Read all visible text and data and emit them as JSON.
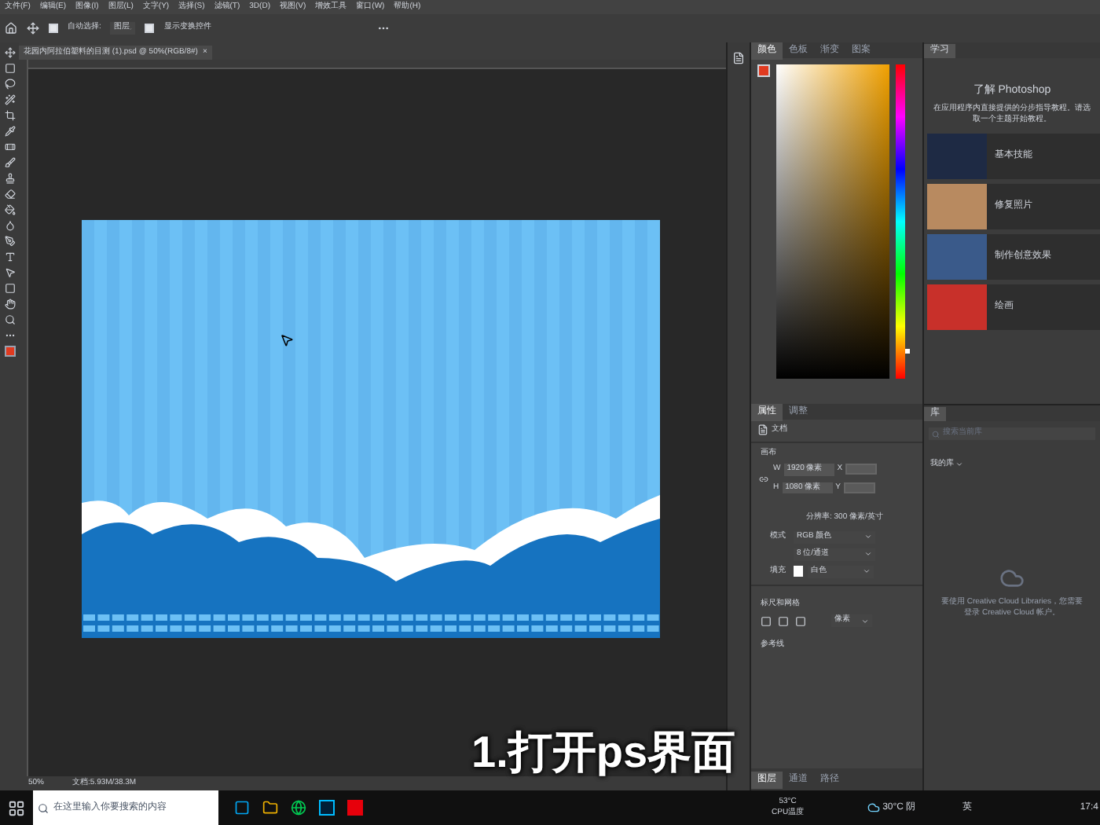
{
  "menu": [
    "文件(F)",
    "编辑(E)",
    "图像(I)",
    "图层(L)",
    "文字(Y)",
    "选择(S)",
    "滤镜(T)",
    "3D(D)",
    "视图(V)",
    "增效工具",
    "窗口(W)",
    "帮助(H)"
  ],
  "options_bar": {
    "auto_select": {
      "label": "自动选择:",
      "checked": true
    },
    "target": "图层",
    "show_transform": {
      "label": "显示变换控件",
      "checked": true
    }
  },
  "document_tab": {
    "title": "花园内阿拉伯塑料的目测 (1).psd @ 50%(RGB/8#)",
    "close": "×"
  },
  "color_panel": {
    "hue": {
      "level": 0.08
    },
    "tabs": [
      {
        "label": "颜色",
        "selected": true
      },
      {
        "label": "色板",
        "selected": false
      },
      {
        "label": "渐变",
        "selected": false
      },
      {
        "label": "图案",
        "selected": false
      }
    ]
  },
  "learn_panel": {
    "tab": "学习",
    "title": "了解 Photoshop",
    "description": "在应用程序内直接提供的分步指导教程。请选取一个主题开始教程。",
    "topics": [
      {
        "label": "基本技能",
        "color": "#1e2a44"
      },
      {
        "label": "修复照片",
        "color": "#b88a60"
      },
      {
        "label": "制作创意效果",
        "color": "#3a5a8a"
      },
      {
        "label": "绘画",
        "color": "#c8302a"
      }
    ]
  },
  "properties_panel": {
    "tabs": [
      {
        "label": "属性",
        "selected": true
      },
      {
        "label": "调整",
        "selected": false
      }
    ],
    "doc_label": "文档",
    "canvas_section": "画布",
    "width_label": "W",
    "width": "1920 像素",
    "x_label": "X",
    "height_label": "H",
    "height": "1080 像素",
    "y_label": "Y",
    "resolution": "分辨率: 300 像素/英寸",
    "mode_label": "模式",
    "mode": "RGB 颜色",
    "depth": "8 位/通道",
    "fill_label": "填充",
    "fill": "白色",
    "rulers_section": "标尺和网格",
    "unit": "像素",
    "guides_section": "参考线"
  },
  "library_panel": {
    "tab": "库",
    "search_placeholder": "搜索当前库",
    "library_select": "我的库",
    "message": "要使用 Creative Cloud Libraries，您需要登录 Creative Cloud 帐户。"
  },
  "bottom_tabs": [
    {
      "label": "图层",
      "selected": true
    },
    {
      "label": "通道",
      "selected": false
    },
    {
      "label": "路径",
      "selected": false
    }
  ],
  "status_bar": {
    "zoom": "50%",
    "doc_size": "文档:5.93M/38.3M"
  },
  "caption": "1.打开ps界面",
  "taskbar": {
    "search_placeholder": "在这里输入你要搜索的内容",
    "cpu_temp": "53°C",
    "cpu_label": "CPU温度",
    "weather": "30°C 阴",
    "ime": "英",
    "clock": "17:4"
  }
}
